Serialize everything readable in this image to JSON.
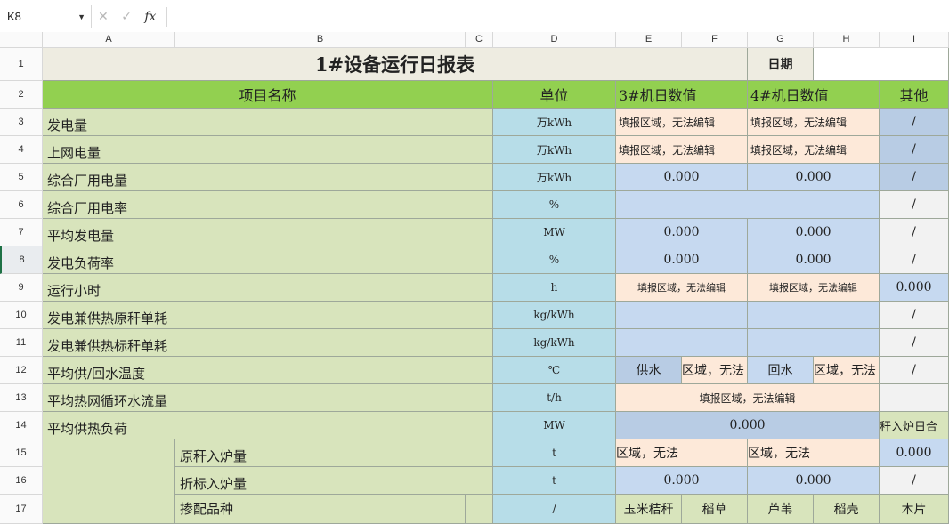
{
  "formula_bar": {
    "name_box": "K8",
    "cancel_icon": "✕",
    "enter_icon": "✓",
    "fx_label": "fx",
    "formula_value": ""
  },
  "columns": [
    "A",
    "B",
    "C",
    "D",
    "E",
    "F",
    "G",
    "H",
    "I"
  ],
  "rows": [
    "1",
    "2",
    "3",
    "4",
    "5",
    "6",
    "7",
    "8",
    "9",
    "10",
    "11",
    "12",
    "13",
    "14",
    "15",
    "16",
    "17"
  ],
  "sheet": {
    "title": "1#设备运行日报表",
    "date_label": "日期",
    "date_value": "",
    "header": {
      "item_name": "项目名称",
      "unit": "单位",
      "unit3": "3#机日数值",
      "unit4": "4#机日数值",
      "other": "其他"
    },
    "locked_text": "填报区域，无法编辑",
    "locked_cut": "区域，无法",
    "slash": "/",
    "r3": {
      "label": "发电量",
      "unit": "万kWh"
    },
    "r4": {
      "label": "上网电量",
      "unit": "万kWh"
    },
    "r5": {
      "label": "综合厂用电量",
      "unit": "万kWh",
      "v3": "0.000",
      "v4": "0.000"
    },
    "r6": {
      "label": "综合厂用电率",
      "unit": "%"
    },
    "r7": {
      "label": "平均发电量",
      "unit": "MW",
      "v3": "0.000",
      "v4": "0.000"
    },
    "r8": {
      "label": "发电负荷率",
      "unit": "%",
      "v3": "0.000",
      "v4": "0.000"
    },
    "r9": {
      "label": "运行小时",
      "unit": "h",
      "other": "0.000"
    },
    "r10": {
      "label": "发电兼供热原秆单耗",
      "unit": "kg/kWh"
    },
    "r11": {
      "label": "发电兼供热标秆单耗",
      "unit": "kg/kWh"
    },
    "r12": {
      "label": "平均供/回水温度",
      "unit": "℃",
      "supply3": "供水",
      "supply4": "回水"
    },
    "r13": {
      "label": "平均热网循环水流量",
      "unit": "t/h"
    },
    "r14": {
      "label": "平均供热负荷",
      "unit": "MW",
      "v": "0.000",
      "other": "秆入炉日合"
    },
    "r15": {
      "label": "原秆入炉量",
      "unit": "t",
      "other": "0.000"
    },
    "r16": {
      "label": "折标入炉量",
      "unit": "t",
      "v3": "0.000",
      "v4": "0.000"
    },
    "r17": {
      "label": "掺配品种",
      "unit": "/",
      "e": "玉米秸秆",
      "f": "稻草",
      "g": "芦苇",
      "h": "稻壳",
      "i": "木片"
    }
  }
}
